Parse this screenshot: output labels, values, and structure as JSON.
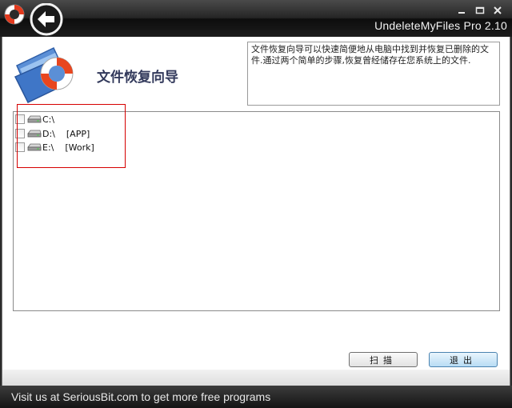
{
  "window": {
    "title": "UndeleteMyFiles Pro 2.10",
    "minimize_glyph": "−",
    "maximize_glyph": "▭",
    "close_glyph": "✕"
  },
  "header": {
    "title": "文件恢复向导",
    "description": "文件恢复向导可以快速简便地从电脑中找到并恢复已删除的文件.通过两个简单的步骤,恢复曾经储存在您系统上的文件."
  },
  "drives": [
    {
      "label": "C:\\",
      "volume": "",
      "checked": false
    },
    {
      "label": "D:\\",
      "volume": "[APP]",
      "checked": false
    },
    {
      "label": "E:\\",
      "volume": "[Work]",
      "checked": false
    }
  ],
  "buttons": {
    "scan_label": "扫描",
    "exit_label": "退出"
  },
  "footer": {
    "link_text": "Visit us at SeriousBit.com to get more free programs"
  },
  "icons": {
    "app_logo": "lifebuoy-icon",
    "back": "back-arrow-icon",
    "header": "folder-lifebuoy-icon",
    "drive": "hard-drive-icon"
  },
  "colors": {
    "titlebar": "#1c1c1c",
    "accent_button": "#b8dcf4",
    "highlight_box": "#d60000"
  }
}
